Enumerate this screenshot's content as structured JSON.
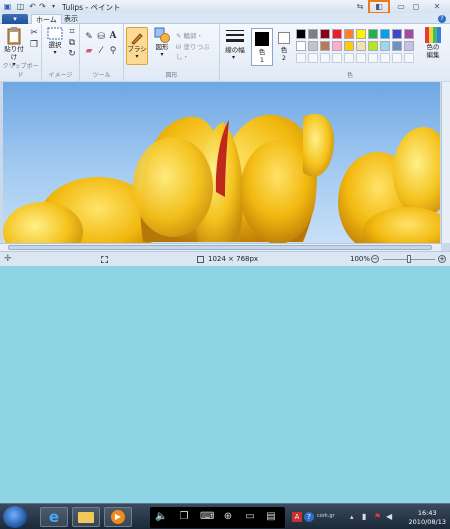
{
  "window": {
    "title": "Tulips - ペイント",
    "quick_access": [
      "save-icon",
      "undo-icon",
      "redo-icon",
      "dropdown-icon"
    ],
    "controls": [
      "minimize-icon",
      "restore-icon",
      "close-icon"
    ]
  },
  "ribbon": {
    "app_button": "▾",
    "tabs": [
      {
        "label": "ホーム",
        "active": true
      },
      {
        "label": "表示",
        "active": false
      }
    ],
    "groups": {
      "clipboard": {
        "label": "クリップボード",
        "paste": "貼り付け"
      },
      "image": {
        "label": "イメージ",
        "select": "選択"
      },
      "tools": {
        "label": "ツール",
        "text_tool": "A"
      },
      "shapes": {
        "label": "図形",
        "brush": "ブラシ",
        "shapes_btn": "図形",
        "outline": "輪郭・",
        "fill": "塗りつぶし・"
      },
      "line_width": {
        "label": "線の幅"
      },
      "colors": {
        "label": "色",
        "color1": "色\n1",
        "color1_label": "色",
        "color1_num": "1",
        "color2_label": "色",
        "color2_num": "2",
        "edit_colors": "色の\n編集",
        "edit_label": "色の",
        "edit_label2": "編集",
        "palette": [
          "#000000",
          "#7f7f7f",
          "#880015",
          "#ed1c24",
          "#ff7f27",
          "#fff200",
          "#22b14c",
          "#00a2e8",
          "#3f48cc",
          "#a349a4",
          "#ffffff",
          "#c3c3c3",
          "#b97a57",
          "#ffaec9",
          "#ffc90e",
          "#efe4b0",
          "#b5e61d",
          "#99d9ea",
          "#7092be",
          "#c8bfe7"
        ]
      }
    }
  },
  "status": {
    "dimensions": "1024 × 768px",
    "zoom": "100%",
    "zoom_level": 0.5
  },
  "taskbar": {
    "clock_time": "16:43",
    "clock_date": "2010/08/13",
    "tray_text": "cork.gr"
  }
}
